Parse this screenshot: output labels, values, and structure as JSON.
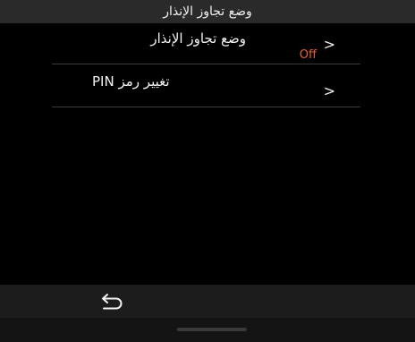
{
  "header": {
    "title": "وضع تجاوز الإنذار"
  },
  "menu": {
    "items": [
      {
        "label": "وضع تجاوز الإنذار",
        "value": "Off",
        "chevron": ">"
      },
      {
        "label": "تغيير رمز PIN",
        "chevron": ">"
      }
    ]
  },
  "bottom_bar": {
    "back_icon": "back-arrow-icon"
  },
  "colors": {
    "background": "#000000",
    "title_bar": "#2a2a2a",
    "bottom_bar": "#1c1c1c",
    "accent_value": "#e8622b"
  }
}
